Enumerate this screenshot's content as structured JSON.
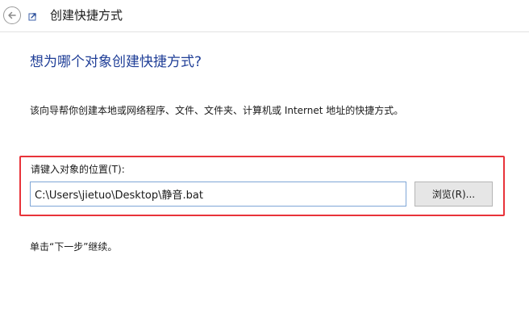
{
  "window": {
    "title": "创建快捷方式",
    "back_icon": "back-arrow-icon",
    "shortcut_icon": "shortcut-icon"
  },
  "page": {
    "heading": "想为哪个对象创建快捷方式?",
    "description": "该向导帮你创建本地或网络程序、文件、文件夹、计算机或 Internet 地址的快捷方式。",
    "location_label": "请键入对象的位置(T):",
    "location_value": "C:\\Users\\jietuo\\Desktop\\静音.bat",
    "browse_label": "浏览(R)...",
    "continue_hint": "单击“下一步”继续。"
  },
  "colors": {
    "heading": "#1f3e97",
    "highlight_border": "#e8333a",
    "input_border": "#7fa6d6"
  }
}
